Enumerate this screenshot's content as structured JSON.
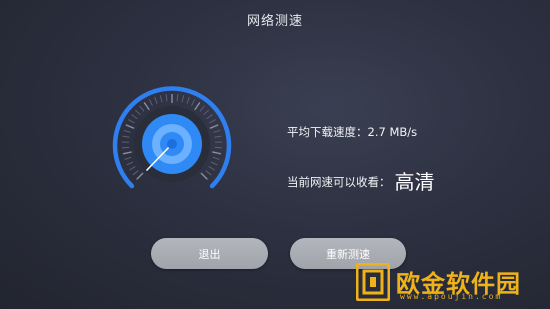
{
  "header": {
    "title": "网络测速"
  },
  "speed": {
    "label": "平均下载速度：",
    "value": "2.7 MB/s"
  },
  "quality": {
    "label": "当前网速可以收看：",
    "value": "高清"
  },
  "buttons": {
    "exit_label": "退出",
    "retest_label": "重新测速"
  },
  "watermark": {
    "brand": "欧金软件园",
    "url": "www.apoujin.com"
  },
  "colors": {
    "accent": "#2f7ff0",
    "accent_light": "#6cb1ff",
    "button": "#a8aab1",
    "watermark": "#f0b219"
  },
  "icons": {
    "gauge": "speedometer-icon",
    "logo": "brand-logo-icon"
  }
}
